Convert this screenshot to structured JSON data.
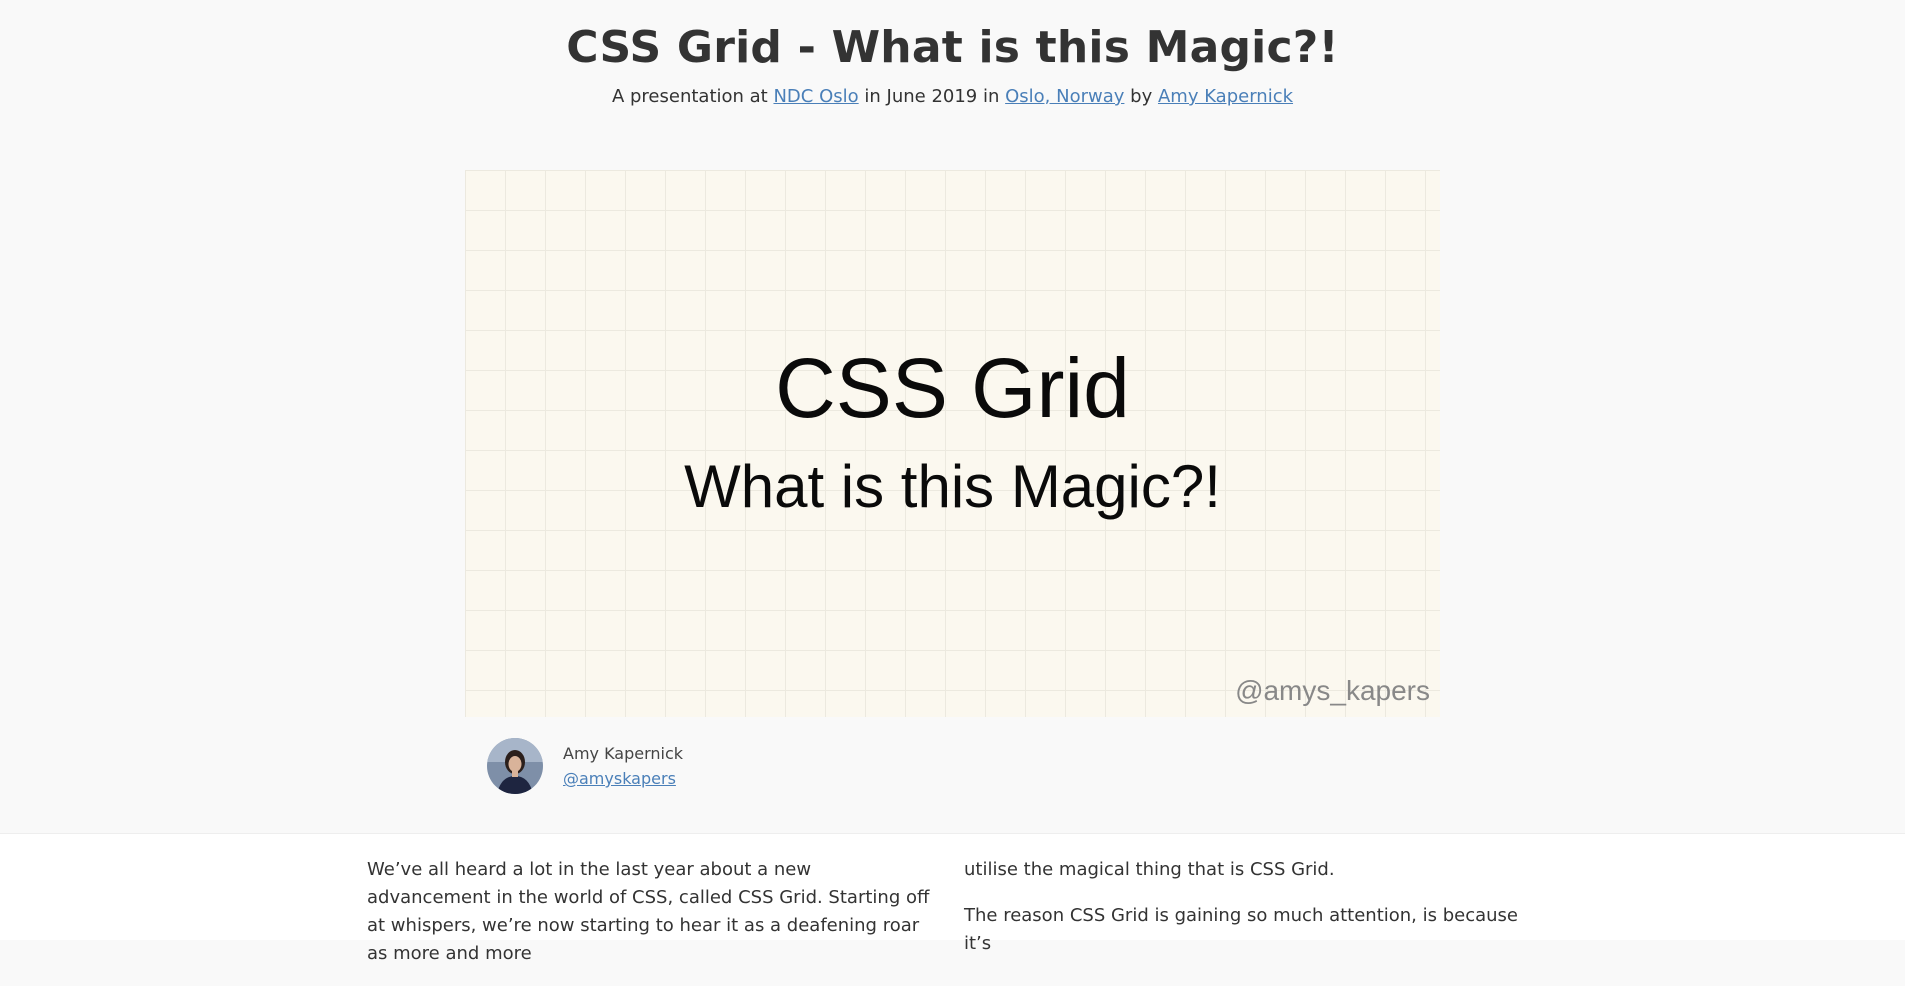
{
  "page": {
    "title": "CSS Grid - What is this Magic?!",
    "subtitle": {
      "prefix": "A presentation at",
      "event": "NDC Oslo",
      "mid1": "in June 2019 in",
      "location": "Oslo, Norway",
      "mid2": "by",
      "author": "Amy Kapernick"
    }
  },
  "slide": {
    "title": "CSS Grid",
    "subtitle": "What is this Magic?!",
    "handle": "@amys_kapers"
  },
  "author": {
    "name": "Amy Kapernick",
    "handle": "@amyskapers"
  },
  "article": {
    "col1": "We’ve all heard a lot in the last year about a new advancement in the world of CSS, called CSS Grid. Starting off at whispers, we’re now starting to hear it as a deafening roar as more and more",
    "col2_p1": "utilise the magical thing that is CSS Grid.",
    "col2_p2": "The reason CSS Grid is gaining so much attention, is because it’s"
  },
  "colors": {
    "link": "#4a7fb8",
    "text": "#333333",
    "slide_bg": "#fbf8ef"
  }
}
